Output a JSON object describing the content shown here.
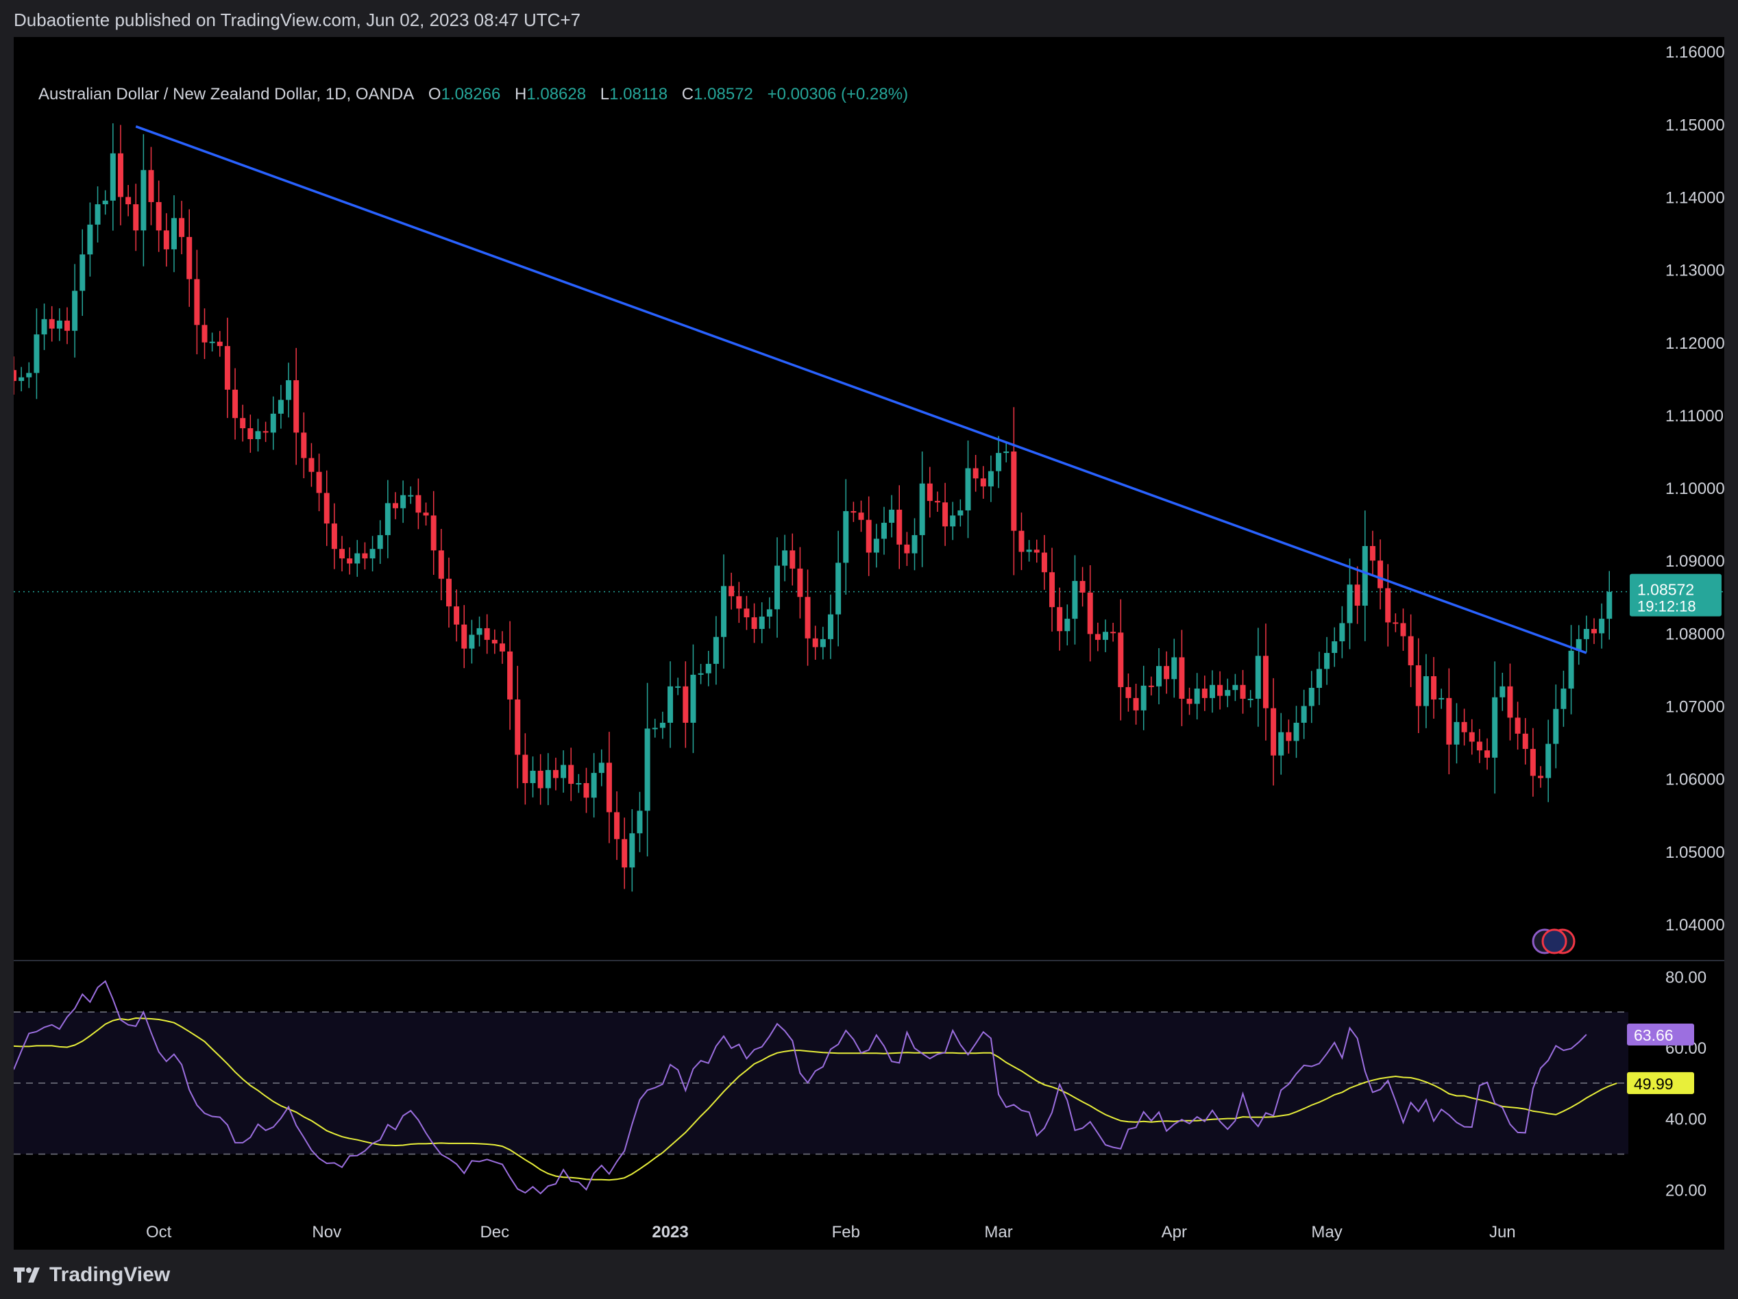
{
  "header": {
    "publisher": "Dubaotiente published on TradingView.com, Jun 02, 2023 08:47 UTC+7"
  },
  "symbol": {
    "name": "Australian Dollar / New Zealand Dollar, 1D, OANDA",
    "open_label": "O",
    "open": "1.08266",
    "high_label": "H",
    "high": "1.08628",
    "low_label": "L",
    "low": "1.08118",
    "close_label": "C",
    "close": "1.08572",
    "change": "+0.00306 (+0.28%)"
  },
  "price_badge": {
    "price": "1.08572",
    "countdown": "19:12:18"
  },
  "rsi_badges": {
    "rsi": "63.66",
    "rsi_ma": "49.99"
  },
  "footer": {
    "brand": "TradingView"
  },
  "colors": {
    "up": "#26a69a",
    "down": "#f23645",
    "trendline": "#2962ff",
    "rsi": "#9c6fe0",
    "rsi_ma": "#e8ef3a",
    "background": "#000000"
  },
  "chart_data": [
    {
      "type": "candlestick",
      "title": "Australian Dollar / New Zealand Dollar, 1D, OANDA",
      "ylim": [
        1.035,
        1.162
      ],
      "yticks": [
        "1.16000",
        "1.15000",
        "1.14000",
        "1.13000",
        "1.12000",
        "1.11000",
        "1.10000",
        "1.09000",
        "1.08000",
        "1.07000",
        "1.06000",
        "1.05000",
        "1.04000"
      ],
      "xticks": [
        {
          "label": "Oct",
          "index": 19
        },
        {
          "label": "Nov",
          "index": 41
        },
        {
          "label": "Dec",
          "index": 63
        },
        {
          "label": "2023",
          "index": 86
        },
        {
          "label": "Feb",
          "index": 109
        },
        {
          "label": "Mar",
          "index": 129
        },
        {
          "label": "Apr",
          "index": 152
        },
        {
          "label": "May",
          "index": 172
        },
        {
          "label": "Jun",
          "index": 195
        }
      ],
      "last_price": 1.08572,
      "trendline": {
        "from": [
          16,
          1.1497
        ],
        "to": [
          206,
          1.0773
        ]
      },
      "close": [
        1.1147,
        1.1152,
        1.1158,
        1.1211,
        1.1232,
        1.1219,
        1.123,
        1.1216,
        1.1271,
        1.1321,
        1.1362,
        1.139,
        1.1395,
        1.146,
        1.14,
        1.139,
        1.1354,
        1.1437,
        1.1393,
        1.1354,
        1.1328,
        1.1371,
        1.1345,
        1.1287,
        1.1224,
        1.12,
        1.1201,
        1.1195,
        1.1135,
        1.1096,
        1.1082,
        1.1067,
        1.1078,
        1.1076,
        1.1102,
        1.1121,
        1.1148,
        1.1076,
        1.1041,
        1.1022,
        1.0993,
        1.0951,
        1.0916,
        1.0903,
        1.0896,
        1.091,
        1.0903,
        1.0916,
        1.0935,
        1.0979,
        1.0972,
        1.099,
        1.099,
        1.0966,
        1.0962,
        1.0914,
        1.0875,
        1.0837,
        1.0812,
        1.0779,
        1.0798,
        1.0807,
        1.0791,
        1.0786,
        1.0775,
        1.0709,
        1.0633,
        1.0594,
        1.0611,
        1.0587,
        1.0612,
        1.0601,
        1.0619,
        1.0593,
        1.0594,
        1.0574,
        1.0608,
        1.0622,
        1.0554,
        1.0517,
        1.0478,
        1.0525,
        1.0556,
        1.0669,
        1.067,
        1.0677,
        1.0727,
        1.0727,
        1.0677,
        1.0743,
        1.0745,
        1.0758,
        1.0795,
        1.0865,
        1.0851,
        1.0834,
        1.0822,
        1.0806,
        1.0823,
        1.0833,
        1.0893,
        1.0914,
        1.0889,
        1.085,
        1.0793,
        1.0781,
        1.0792,
        1.0826,
        1.0897,
        1.0968,
        1.0966,
        1.0956,
        1.0911,
        1.093,
        1.0952,
        1.097,
        1.0922,
        1.091,
        1.0935,
        1.1006,
        1.0982,
        1.098,
        1.0947,
        1.0962,
        1.0969,
        1.1027,
        1.1013,
        1.1002,
        1.1023,
        1.1048,
        1.105,
        1.0941,
        1.0912,
        1.0915,
        1.0911,
        1.0884,
        1.0836,
        1.0803,
        1.082,
        1.0872,
        1.0856,
        1.0799,
        1.0791,
        1.0802,
        1.0801,
        1.0726,
        1.0711,
        1.0694,
        1.0728,
        1.0727,
        1.0755,
        1.0737,
        1.0767,
        1.071,
        1.0703,
        1.0724,
        1.0711,
        1.0729,
        1.0714,
        1.0722,
        1.0729,
        1.071,
        1.071,
        1.0769,
        1.0697,
        1.0632,
        1.0664,
        1.0652,
        1.0677,
        1.07,
        1.0725,
        1.0751,
        1.0773,
        1.0789,
        1.0814,
        1.0867,
        1.0838,
        1.092,
        1.09,
        1.0862,
        1.0815,
        1.0814,
        1.0796,
        1.0756,
        1.07,
        1.0741,
        1.0709,
        1.0711,
        1.0647,
        1.0678,
        1.0664,
        1.0651,
        1.0639,
        1.0629,
        1.0712,
        1.0727,
        1.0684,
        1.0662,
        1.0641,
        1.0604,
        1.0601,
        1.0648,
        1.0696,
        1.0724,
        1.0776,
        1.0792,
        1.0806,
        1.08,
        1.082,
        1.0857
      ],
      "series": [
        {
          "name": "RSI",
          "values": [
            53.8,
            59.0,
            64.0,
            64.5,
            65.7,
            66.4,
            65.2,
            68.6,
            71.0,
            75.0,
            72.8,
            76.9,
            78.7,
            73.6,
            67.8,
            66.4,
            66.0,
            70.0,
            64.2,
            58.8,
            56.1,
            58.1,
            55.2,
            48.1,
            43.8,
            41.5,
            40.6,
            40.4,
            38.2,
            33.2,
            33.2,
            34.7,
            38.4,
            36.7,
            37.6,
            40.1,
            43.3,
            38.1,
            34.7,
            31.1,
            28.8,
            27.4,
            27.5,
            26.3,
            29.5,
            29.6,
            30.9,
            33.0,
            34.0,
            38.3,
            36.9,
            40.8,
            42.2,
            39.6,
            35.9,
            32.7,
            29.9,
            28.7,
            27.2,
            24.6,
            28.1,
            27.9,
            28.5,
            27.8,
            27.1,
            23.5,
            20.2,
            19.1,
            20.8,
            18.9,
            21.0,
            21.6,
            25.6,
            22.4,
            22.1,
            20.0,
            24.6,
            26.8,
            24.4,
            27.9,
            30.9,
            38.4,
            45.3,
            48.0,
            48.7,
            49.7,
            55.2,
            53.7,
            47.9,
            54.0,
            56.3,
            55.6,
            60.4,
            63.2,
            59.8,
            60.9,
            56.9,
            59.4,
            60.2,
            63.2,
            66.7,
            64.7,
            61.9,
            52.8,
            50.1,
            53.4,
            54.6,
            59.5,
            60.9,
            64.8,
            62.3,
            58.5,
            59.3,
            63.5,
            60.4,
            56.1,
            55.7,
            64.3,
            59.8,
            58.3,
            56.9,
            58.1,
            58.6,
            64.8,
            60.8,
            58.0,
            61.1,
            64.4,
            62.6,
            46.8,
            43.2,
            43.9,
            42.3,
            41.8,
            35.2,
            37.3,
            41.7,
            49.6,
            45.1,
            36.7,
            37.3,
            39.1,
            35.9,
            32.6,
            31.9,
            31.5,
            37.0,
            37.5,
            41.9,
            39.4,
            41.8,
            36.5,
            38.4,
            39.7,
            38.6,
            40.5,
            39.2,
            42.3,
            39.2,
            37.0,
            39.4,
            47.0,
            40.2,
            37.8,
            41.6,
            40.8,
            48.0,
            49.7,
            52.6,
            55.0,
            54.7,
            55.5,
            58.3,
            61.4,
            57.1,
            65.5,
            62.6,
            53.3,
            47.4,
            48.2,
            50.7,
            45.0,
            38.9,
            44.5,
            42.0,
            45.3,
            39.3,
            42.6,
            41.0,
            38.9,
            37.7,
            37.6,
            49.3,
            50.2,
            44.3,
            43.1,
            38.4,
            36.1,
            36.0,
            48.5,
            54.2,
            56.4,
            60.5,
            59.2,
            59.7,
            61.5,
            63.66
          ]
        },
        {
          "name": "RSI-based MA",
          "values": [
            60.4,
            60.3,
            60.3,
            60.5,
            60.5,
            60.5,
            60.2,
            60.1,
            60.7,
            61.8,
            63.3,
            64.9,
            66.6,
            67.6,
            68.1,
            67.8,
            68.3,
            68.2,
            68.1,
            67.9,
            67.5,
            67.0,
            65.8,
            64.5,
            63.1,
            61.7,
            59.6,
            57.5,
            55.4,
            53.1,
            51.1,
            49.3,
            47.9,
            46.3,
            44.8,
            43.6,
            42.7,
            41.8,
            40.5,
            39.4,
            38.0,
            36.6,
            35.7,
            34.9,
            34.4,
            34.0,
            33.5,
            33.0,
            32.6,
            32.5,
            32.4,
            32.5,
            32.8,
            32.9,
            32.9,
            33.0,
            33.1,
            33.0,
            33.0,
            33.0,
            33.0,
            32.9,
            32.8,
            32.6,
            32.2,
            31.2,
            29.8,
            28.4,
            27.1,
            25.6,
            24.5,
            23.8,
            23.5,
            23.4,
            23.2,
            22.9,
            22.8,
            22.8,
            22.7,
            22.9,
            23.3,
            24.4,
            25.8,
            27.3,
            28.9,
            30.4,
            32.3,
            34.2,
            36.1,
            38.4,
            40.7,
            42.8,
            45.2,
            47.6,
            49.8,
            51.9,
            53.6,
            55.4,
            56.4,
            57.6,
            58.5,
            58.9,
            59.2,
            59.2,
            59.0,
            58.8,
            58.6,
            58.5,
            58.4,
            58.4,
            58.4,
            58.4,
            58.4,
            58.4,
            58.3,
            58.4,
            58.5,
            58.6,
            58.5,
            58.5,
            58.5,
            58.6,
            58.5,
            58.5,
            58.4,
            58.4,
            58.4,
            58.5,
            58.5,
            57.3,
            55.8,
            54.6,
            53.4,
            52.0,
            50.6,
            49.5,
            48.9,
            48.1,
            47.1,
            45.9,
            44.7,
            43.6,
            42.3,
            41.1,
            40.2,
            39.4,
            39.1,
            39.0,
            39.2,
            39.0,
            39.2,
            39.3,
            39.2,
            39.4,
            39.4,
            39.4,
            39.6,
            39.8,
            39.9,
            40.0,
            40.0,
            40.5,
            40.4,
            40.4,
            40.4,
            40.5,
            40.8,
            41.1,
            41.9,
            42.8,
            43.8,
            44.6,
            45.6,
            46.7,
            47.4,
            48.6,
            49.4,
            50.2,
            50.8,
            51.3,
            51.6,
            51.9,
            51.6,
            51.5,
            51.0,
            50.3,
            49.4,
            48.3,
            47.0,
            46.4,
            46.4,
            45.8,
            45.3,
            44.8,
            44.1,
            43.4,
            43.2,
            43.0,
            42.7,
            42.1,
            41.8,
            41.4,
            41.1,
            42.1,
            43.2,
            44.4,
            45.8,
            47.0,
            48.2,
            49.2,
            49.99
          ]
        }
      ],
      "rsi_ylim": [
        13.5,
        84.5
      ],
      "rsi_yticks": [
        "80.00",
        "60.00",
        "40.00",
        "20.00"
      ],
      "rsi_bands": [
        70,
        50,
        30
      ]
    }
  ]
}
